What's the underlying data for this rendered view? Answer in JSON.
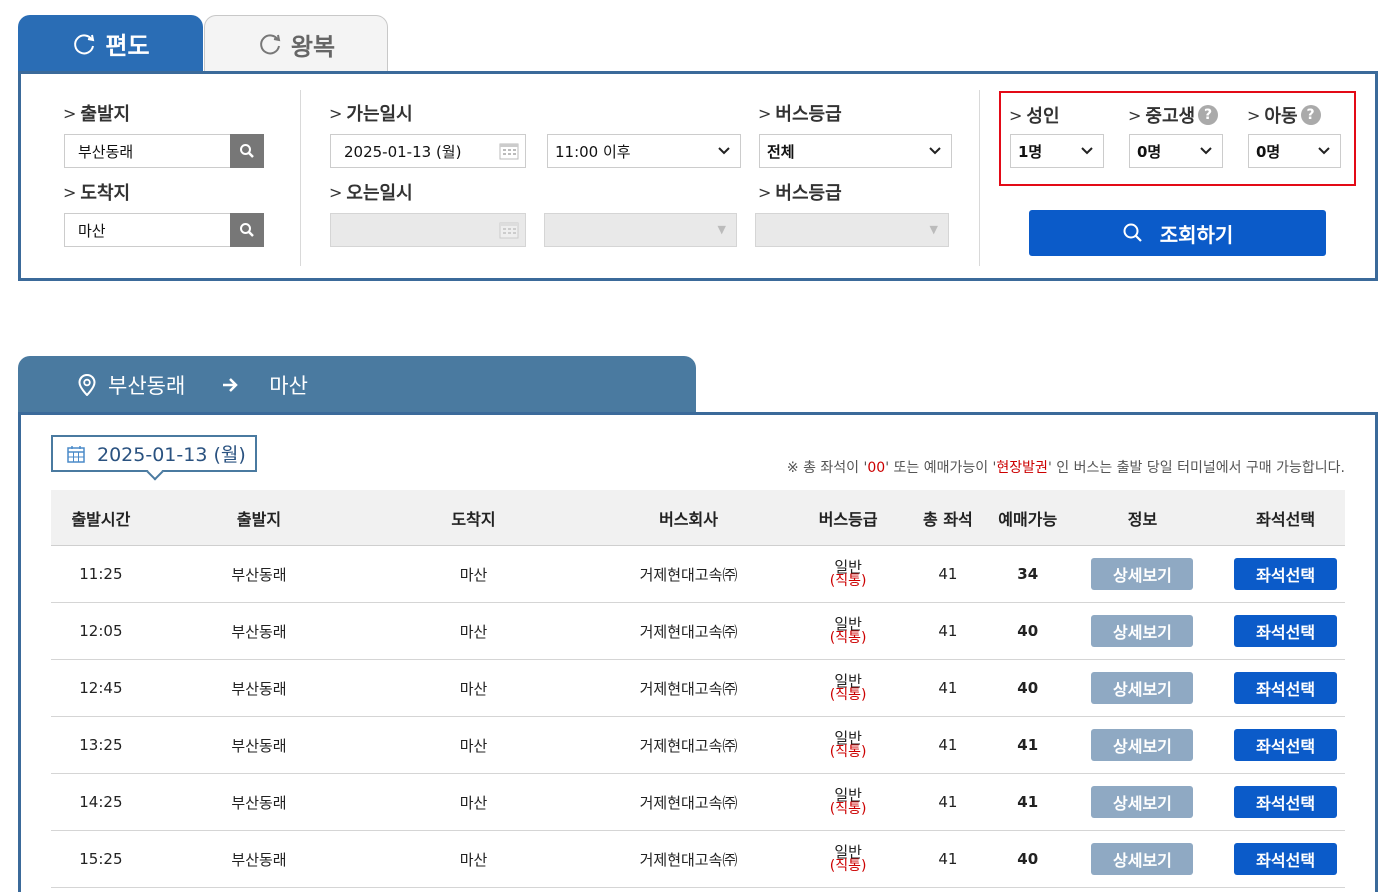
{
  "tabs": {
    "one_way": "편도",
    "round_trip": "왕복"
  },
  "search": {
    "departure_label": "출발지",
    "departure_value": "부산동래",
    "arrival_label": "도착지",
    "arrival_value": "마산",
    "go_date_label": "가는일시",
    "go_date_value": "2025-01-13 (월)",
    "go_time_value": "11:00 이후",
    "bus_grade_label": "버스등급",
    "bus_grade_value": "전체",
    "return_date_label": "오는일시",
    "return_bus_grade_label": "버스등급",
    "adult_label": "성인",
    "adult_value": "1명",
    "student_label": "중고생",
    "student_value": "0명",
    "child_label": "아동",
    "child_value": "0명",
    "query_button": "조회하기"
  },
  "route": {
    "from": "부산동래",
    "to": "마산"
  },
  "results": {
    "date": "2025-01-13 (월)",
    "notice_pre": "※ 총 좌석이 '",
    "notice_zero": "00",
    "notice_mid": "' 또는 예매가능이 '",
    "notice_onsite": "현장발권",
    "notice_post": "' 인 버스는 출발 당일 터미널에서 구매 가능합니다.",
    "headers": [
      "출발시간",
      "출발지",
      "도착지",
      "버스회사",
      "버스등급",
      "총 좌석",
      "예매가능",
      "정보",
      "좌석선택"
    ],
    "rows": [
      {
        "time": "11:25",
        "from": "부산동래",
        "to": "마산",
        "company": "거제현대고속㈜",
        "grade": "일반",
        "grade_note": "(직통)",
        "total": "41",
        "avail": "34",
        "detail": "상세보기",
        "select": "좌석선택"
      },
      {
        "time": "12:05",
        "from": "부산동래",
        "to": "마산",
        "company": "거제현대고속㈜",
        "grade": "일반",
        "grade_note": "(직통)",
        "total": "41",
        "avail": "40",
        "detail": "상세보기",
        "select": "좌석선택"
      },
      {
        "time": "12:45",
        "from": "부산동래",
        "to": "마산",
        "company": "거제현대고속㈜",
        "grade": "일반",
        "grade_note": "(직통)",
        "total": "41",
        "avail": "40",
        "detail": "상세보기",
        "select": "좌석선택"
      },
      {
        "time": "13:25",
        "from": "부산동래",
        "to": "마산",
        "company": "거제현대고속㈜",
        "grade": "일반",
        "grade_note": "(직통)",
        "total": "41",
        "avail": "41",
        "detail": "상세보기",
        "select": "좌석선택"
      },
      {
        "time": "14:25",
        "from": "부산동래",
        "to": "마산",
        "company": "거제현대고속㈜",
        "grade": "일반",
        "grade_note": "(직통)",
        "total": "41",
        "avail": "41",
        "detail": "상세보기",
        "select": "좌석선택"
      },
      {
        "time": "15:25",
        "from": "부산동래",
        "to": "마산",
        "company": "거제현대고속㈜",
        "grade": "일반",
        "grade_note": "(직통)",
        "total": "41",
        "avail": "40",
        "detail": "상세보기",
        "select": "좌석선택"
      }
    ]
  },
  "colors": {
    "primary": "#2a6db5",
    "border": "#3b6a9a",
    "button": "#0b5bc9",
    "detail_button": "#8fa9c3",
    "highlight": "#e30a17",
    "route_tab": "#4a7aa0"
  }
}
